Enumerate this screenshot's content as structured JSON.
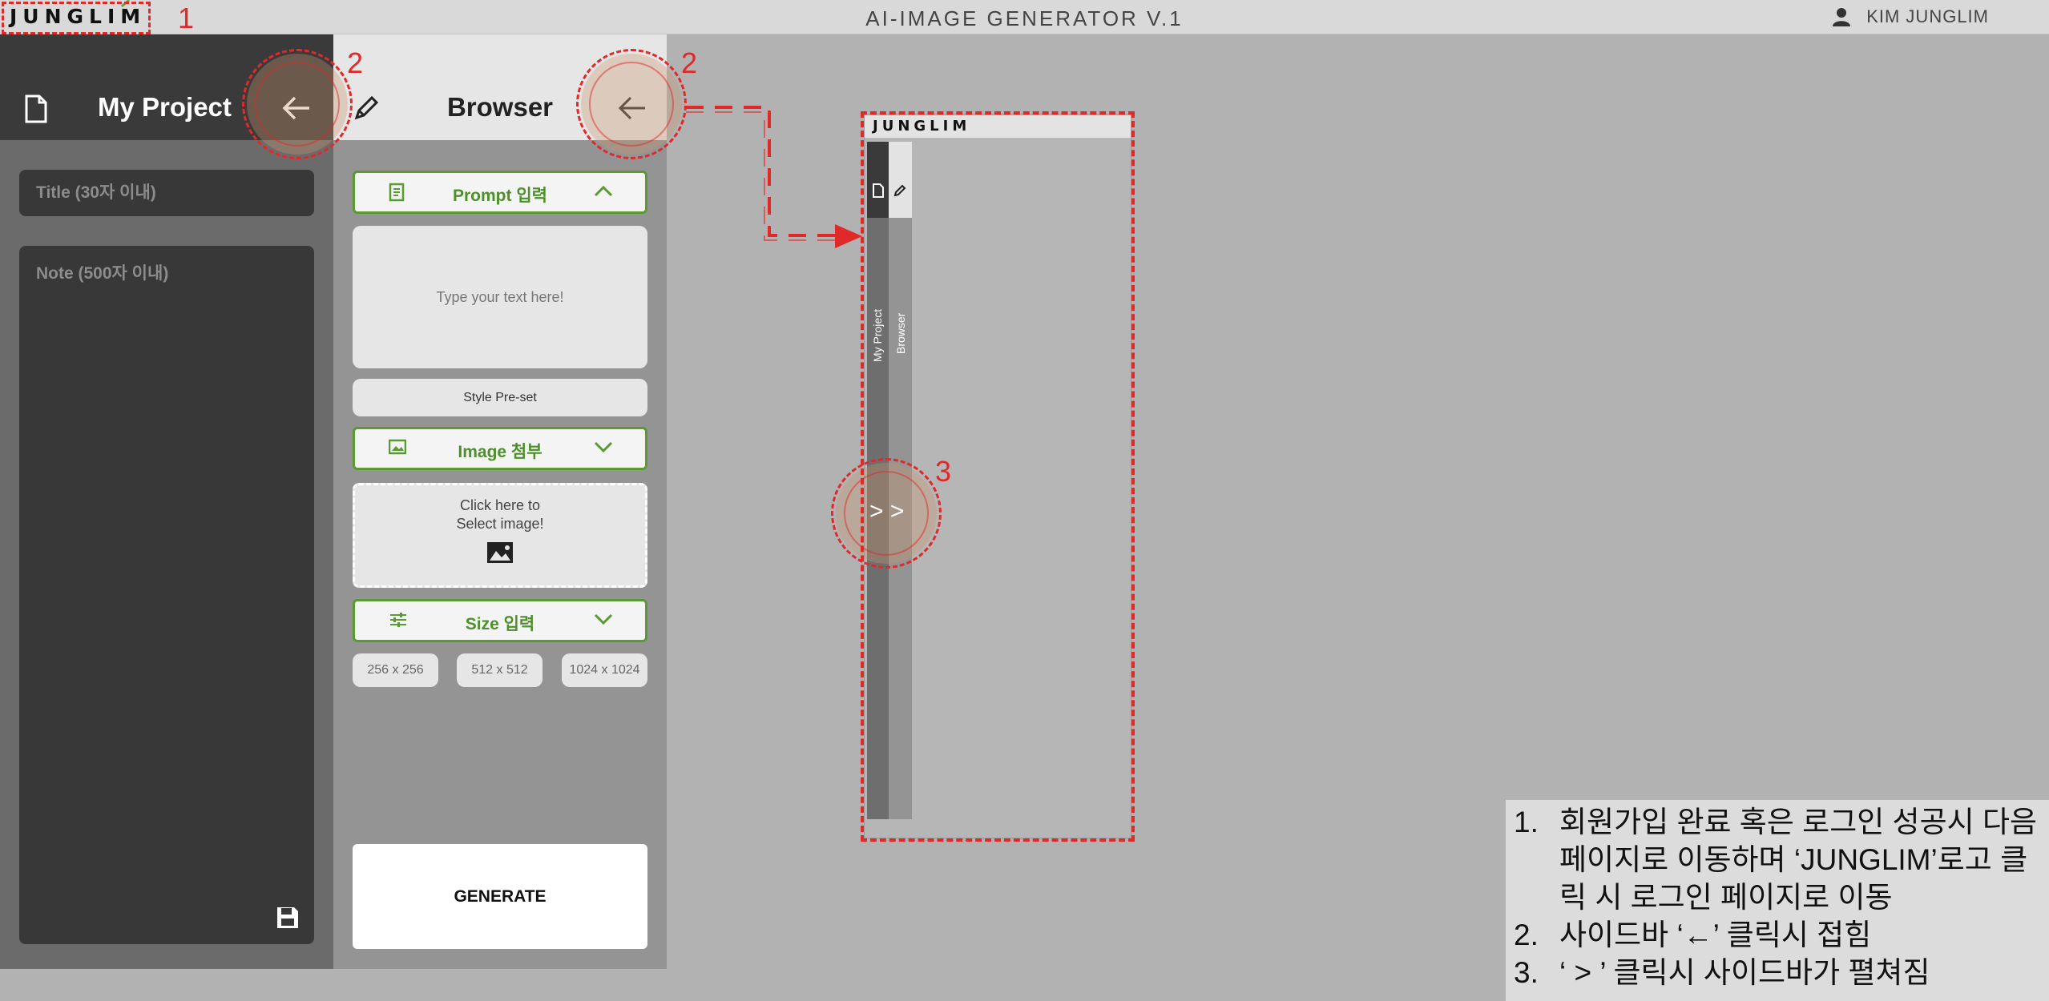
{
  "header": {
    "logo": "JUNGLIM",
    "app_title": "AI-IMAGE GENERATOR V.1",
    "user_name": "KIM JUNGLIM"
  },
  "project_panel": {
    "title": "My Project",
    "title_placeholder": "Title (30자 이내)",
    "note_placeholder": "Note (500자 이내)"
  },
  "browser_panel": {
    "title": "Browser",
    "prompt_section": "Prompt 입력",
    "prompt_placeholder": "Type your text here!",
    "style_preset": "Style Pre-set",
    "image_section": "Image 첨부",
    "image_drop_line1": "Click here to",
    "image_drop_line2": "Select image!",
    "size_section": "Size 입력",
    "sizes": [
      "256 x 256",
      "512 x 512",
      "1024 x 1024"
    ],
    "generate": "GENERATE"
  },
  "preview": {
    "logo": "JUNGLIM",
    "tab_project": "My Project",
    "tab_browser": "Browser",
    "expand_glyph": "> >"
  },
  "annotations": {
    "num1": "1",
    "num2": "2",
    "num3": "3",
    "accent_color": "#e02a2a"
  },
  "notes": {
    "items": [
      {
        "num": "1.",
        "text": "회원가입 완료 혹은 로그인 성공시 다음 페이지로 이동하며 ‘JUNGLIM’로고 클릭 시 로그인 페이지로 이동"
      },
      {
        "num": "2.",
        "text": "사이드바 ‘←’ 클릭시 접힘"
      },
      {
        "num": "3.",
        "text": "‘ > ’ 클릭시 사이드바가 펼쳐짐"
      }
    ]
  },
  "colors": {
    "green": "#5a9a32",
    "dark_panel": "#3a3a3a",
    "background": "#b2b2b2"
  }
}
